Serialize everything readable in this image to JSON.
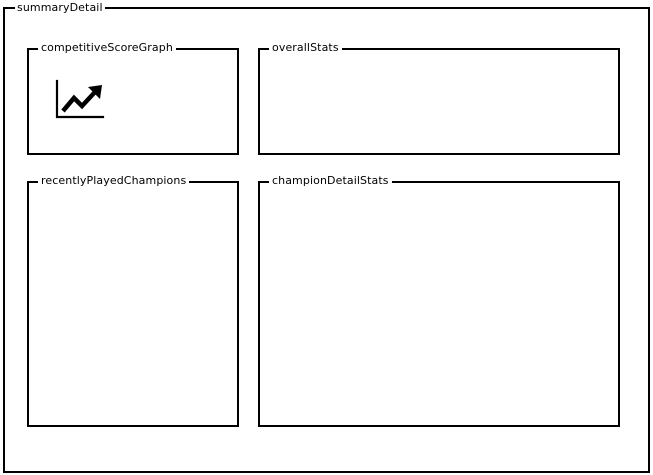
{
  "summary_detail": {
    "label": "summaryDetail"
  },
  "panels": {
    "competitive_score_graph": {
      "label": "competitiveScoreGraph",
      "icon": "line-chart-icon"
    },
    "overall_stats": {
      "label": "overallStats"
    },
    "recently_played_champions": {
      "label": "recentlyPlayedChampions"
    },
    "champion_detail_stats": {
      "label": "championDetailStats"
    }
  },
  "colors": {
    "stroke": "#000000",
    "background": "#ffffff"
  }
}
